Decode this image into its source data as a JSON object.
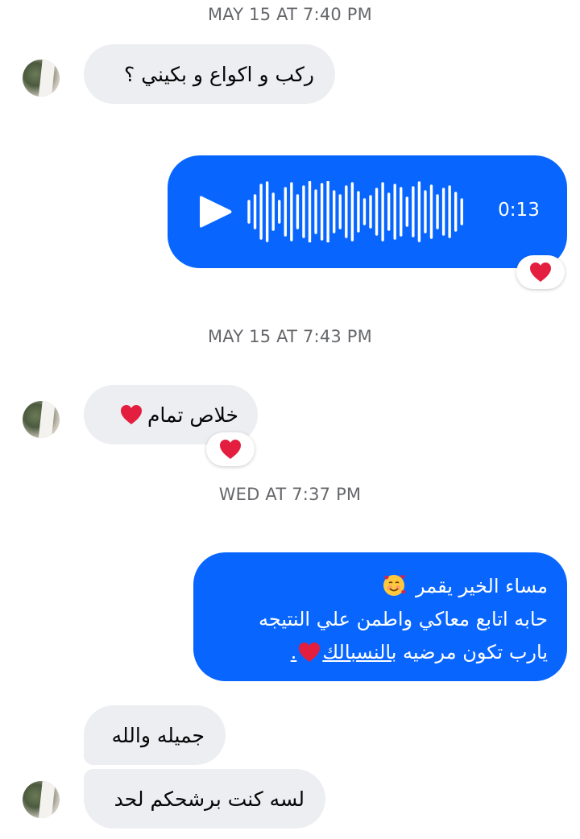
{
  "timestamps": [
    "MAY 15 AT 7:40 PM",
    "MAY 15 AT 7:43 PM",
    "WED AT 7:37 PM"
  ],
  "messages": {
    "m1": "ركب و اكواع و بكيني ؟",
    "voice": {
      "duration": "0:13",
      "reaction": "red-heart"
    },
    "m2": "خلاص تمام",
    "m2_reaction": "red-heart",
    "m3": {
      "line1": "مساء الخير يقمر",
      "line2": "حابه اتابع معاكي واطمن علي النتيجه",
      "line3_pre": "يارب تكون مرضيه ",
      "line3_link": "بالنسبالك",
      "line3_post": "."
    },
    "m4": "جميله والله",
    "m5": "لسه كنت برشحكم لحد"
  },
  "colors": {
    "outgoing_bubble": "#0866ff",
    "incoming_bubble": "#eceef1",
    "timestamp": "#65676b",
    "heart": "#e41e3f"
  },
  "icons": [
    "play-icon",
    "waveform-icon",
    "red-heart-icon",
    "smiling-face-with-hearts-emoji"
  ]
}
